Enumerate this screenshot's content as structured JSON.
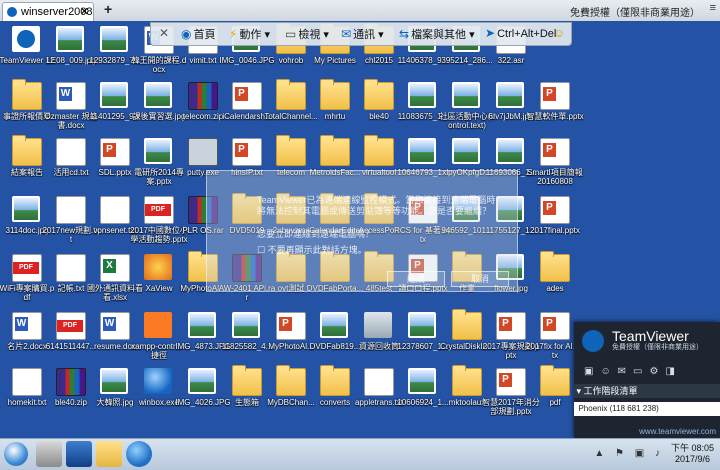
{
  "tabbar": {
    "tab_label": "winserver2008",
    "close_label": "✕",
    "new_tab_label": "+",
    "license_text": "免費授權（僅限非商業用途）",
    "menu_label": "≡"
  },
  "toolbar": {
    "close_glyph": "✕",
    "home_label": "首頁",
    "actions_label": "動作",
    "view_label": "檢視",
    "comm_label": "通訊",
    "files_label": "檔案與其他",
    "cad_label": "Ctrl+Alt+Del"
  },
  "icons": [
    {
      "label": "TeamViewer 12",
      "type": "tv"
    },
    {
      "label": "LE08_009.jpg",
      "type": "image"
    },
    {
      "label": "12932879_7...",
      "type": "image"
    },
    {
      "label": "韓王開的課程.docx",
      "type": "word"
    },
    {
      "label": "vimit.txt",
      "type": "doc"
    },
    {
      "label": "IMG_0046.JPG",
      "type": "image"
    },
    {
      "label": "vohrob",
      "type": "folder"
    },
    {
      "label": "My Pictures",
      "type": "folder"
    },
    {
      "label": "chl2015",
      "type": "folder"
    },
    {
      "label": "11406378_9...",
      "type": "image"
    },
    {
      "label": "395214_286...",
      "type": "image"
    },
    {
      "label": "322.asr",
      "type": "doc"
    },
    {
      "label": "事證所報價單",
      "type": "folder"
    },
    {
      "label": "Ozmaster 規格書.docx",
      "type": "word"
    },
    {
      "label": "11401295_9...",
      "type": "image"
    },
    {
      "label": "課後實習選.jpg",
      "type": "image"
    },
    {
      "label": "telecom.zip",
      "type": "zip"
    },
    {
      "label": "iCalendarsh...",
      "type": "ppt"
    },
    {
      "label": "TotalChannel...",
      "type": "folder"
    },
    {
      "label": "mhrtu",
      "type": "folder"
    },
    {
      "label": "ble40",
      "type": "folder"
    },
    {
      "label": "11083675_1...",
      "type": "image"
    },
    {
      "label": "社區活動中心(control.text)",
      "type": "image"
    },
    {
      "label": "6Iv7jJbM.jpg",
      "type": "image"
    },
    {
      "label": "智慧軟件單.pptx",
      "type": "ppt"
    },
    {
      "label": "結案報告",
      "type": "folder"
    },
    {
      "label": "活用cd.txt",
      "type": "doc"
    },
    {
      "label": "SDL.pptx",
      "type": "ppt"
    },
    {
      "label": "電研所2014專案.pptx",
      "type": "image"
    },
    {
      "label": "putty.exe",
      "type": "putty"
    },
    {
      "label": "hinsIP.txt",
      "type": "ppt"
    },
    {
      "label": "telecom",
      "type": "folder"
    },
    {
      "label": "MetroidsFac...",
      "type": "folder"
    },
    {
      "label": "virtualtool",
      "type": "folder"
    },
    {
      "label": "10646793_1...",
      "type": "image"
    },
    {
      "label": "xlpyOKpfgD...",
      "type": "image"
    },
    {
      "label": "11693066_1...",
      "type": "image"
    },
    {
      "label": "SmartI項目簡報20160808",
      "type": "ppt"
    },
    {
      "label": "3114doc.jpg",
      "type": "image"
    },
    {
      "label": "2017new規劃.txt",
      "type": "doc"
    },
    {
      "label": "vpnsenet.txt",
      "type": "doc"
    },
    {
      "label": "2017中國數位小學活動趨勢.pptx",
      "type": "pdf"
    },
    {
      "label": "PLR OS.rar",
      "type": "zip"
    },
    {
      "label": "DVD5019",
      "type": "folder"
    },
    {
      "label": "2ubuvzms",
      "type": "folder"
    },
    {
      "label": "iCalendarEditor",
      "type": "folder"
    },
    {
      "label": "AccessPort",
      "type": "folder"
    },
    {
      "label": "RCS for 基著.pptx",
      "type": "ppt"
    },
    {
      "label": "946592_101...",
      "type": "image"
    },
    {
      "label": "11755127_1...",
      "type": "image"
    },
    {
      "label": "2017final.pptx",
      "type": "ppt"
    },
    {
      "label": "WiFi專案購買.pdf",
      "type": "pdf"
    },
    {
      "label": "記帳.txt",
      "type": "doc"
    },
    {
      "label": "國外通訊資料看看.xlsx",
      "type": "xls"
    },
    {
      "label": "XaView",
      "type": "xaview"
    },
    {
      "label": "MyPhotoAl...",
      "type": "folder"
    },
    {
      "label": "AW-2401 APi.rar",
      "type": "zip"
    },
    {
      "label": "ovt測試",
      "type": "folder"
    },
    {
      "label": "DVDFabPorta...",
      "type": "folder"
    },
    {
      "label": "485test",
      "type": "folder"
    },
    {
      "label": "讀口口程.pptx",
      "type": "ppt"
    },
    {
      "label": "作業",
      "type": "folder"
    },
    {
      "label": "flower.jpg",
      "type": "image"
    },
    {
      "label": "ades",
      "type": "folder"
    },
    {
      "label": "名片2.docx",
      "type": "word"
    },
    {
      "label": "6141511447...",
      "type": "pdf"
    },
    {
      "label": "resume.doc",
      "type": "word"
    },
    {
      "label": "xampp-contr... - 捷徑",
      "type": "xampp"
    },
    {
      "label": "IMG_4873.JPG",
      "type": "image"
    },
    {
      "label": "11825582_4...",
      "type": "image"
    },
    {
      "label": "MyPhotoAl...",
      "type": "ppt"
    },
    {
      "label": "DVDFab819...",
      "type": "image"
    },
    {
      "label": "資源回收筒",
      "type": "trash"
    },
    {
      "label": "12378607_1...",
      "type": "image"
    },
    {
      "label": "CrystalDiskIn...",
      "type": "folder"
    },
    {
      "label": "2017專案規劃.pptx",
      "type": "ppt"
    },
    {
      "label": "2017fix for AI.pptx",
      "type": "ppt"
    },
    {
      "label": "homekit.txt",
      "type": "doc"
    },
    {
      "label": "ble40.zip",
      "type": "zip"
    },
    {
      "label": "大韓照.jpg",
      "type": "image"
    },
    {
      "label": "winbox.exe",
      "type": "globe"
    },
    {
      "label": "IMG_4026.JPG",
      "type": "image"
    },
    {
      "label": "生態箱",
      "type": "folder"
    },
    {
      "label": "MyDBChan...",
      "type": "folder"
    },
    {
      "label": "converts",
      "type": "folder"
    },
    {
      "label": "appletrans.txt",
      "type": "doc"
    },
    {
      "label": "10606924_1...",
      "type": "image"
    },
    {
      "label": "mktoolaux",
      "type": "folder"
    },
    {
      "label": "智慧2017年消分部規劃.pptx",
      "type": "ppt"
    },
    {
      "label": "pdf",
      "type": "folder"
    }
  ],
  "dialog": {
    "message": "TeamViewer已為遠端連線監控模式。當您連接到遠端電腦時將無法控制其電腦或傳送剪貼簿等等功能。您是否要繼續？",
    "sub_message": "您要立即連線到遠端電腦嗎？",
    "checkbox_label": "不要再顯示此對話方塊。",
    "ok_label": "繼續",
    "cancel_label": "取消"
  },
  "tvpanel": {
    "brand": "TeamViewer",
    "subtitle": "免費授權（僅限非商業用途）",
    "session_title": "▾ 工作階段清單",
    "peer_label": "Phoenix (118 681 238)",
    "website": "www.teamviewer.com"
  },
  "taskbar": {
    "tray_icons": "▲ ⚑ ▣ ♪",
    "time": "下午 08:05",
    "date": "2017/9/6"
  }
}
